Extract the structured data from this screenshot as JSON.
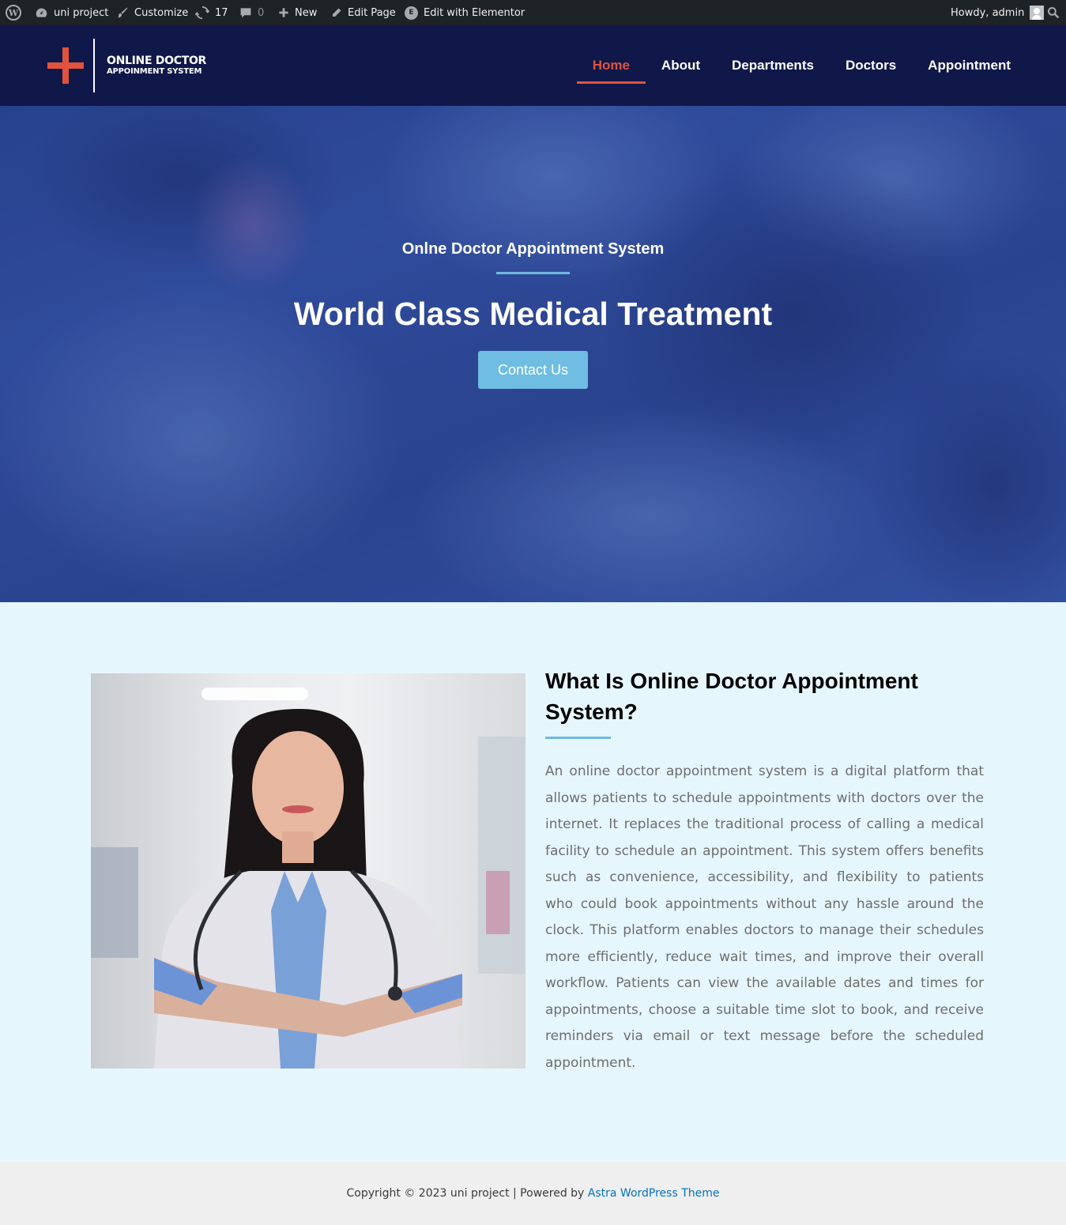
{
  "admin_bar": {
    "site_name": "uni project",
    "customize": "Customize",
    "updates_count": "17",
    "comments_count": "0",
    "new": "New",
    "edit_page": "Edit Page",
    "edit_with_elementor": "Edit with Elementor",
    "greeting": "Howdy, admin",
    "icons": [
      "wordpress-icon",
      "dashboard-icon",
      "brush-icon",
      "updates-icon",
      "comment-icon",
      "plus-icon",
      "pencil-icon",
      "elementor-icon",
      "avatar",
      "search-icon"
    ]
  },
  "header": {
    "logo_line1": "ONLINE DOCTOR",
    "logo_line2": "APPOINMENT SYSTEM",
    "nav": [
      "Home",
      "About",
      "Departments",
      "Doctors",
      "Appointment"
    ],
    "active_nav": "Home",
    "accent_color": "#e0533d",
    "background": "#10184a"
  },
  "hero": {
    "subtitle": "Onlne Doctor Appointment System",
    "title": "World Class Medical Treatment",
    "button": "Contact Us",
    "button_color": "#6fbde3"
  },
  "about": {
    "title": "What Is Online Doctor Appointment System?",
    "text": "An online doctor appointment system is a digital platform that allows patients to schedule appointments with doctors over the internet. It replaces the traditional process of calling a medical facility to schedule an appointment. This system offers benefits such as convenience, accessibility, and flexibility to patients who could book appointments without any hassle around the clock. This platform enables doctors to manage their schedules more efficiently, reduce wait times, and improve their overall workflow. Patients can view the available dates and times for appointments, choose a suitable time slot to book, and receive reminders via email or text message before the scheduled appointment."
  },
  "footer": {
    "copyright": "Copyright © 2023 uni project | Powered by ",
    "theme_link": "Astra WordPress Theme"
  }
}
